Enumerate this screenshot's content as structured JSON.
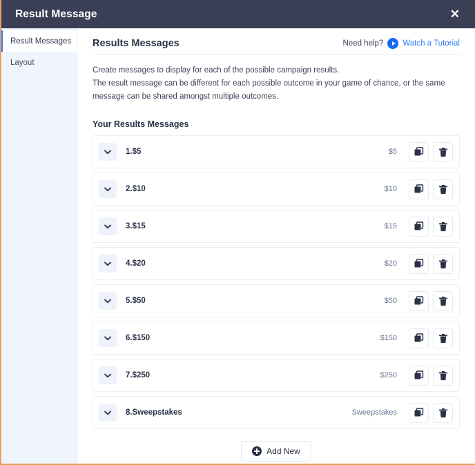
{
  "titlebar": {
    "title": "Result Message",
    "close_label": "✕"
  },
  "sidebar": {
    "items": [
      {
        "label": "Result Messages",
        "active": true
      },
      {
        "label": "Layout",
        "active": false
      }
    ]
  },
  "main": {
    "title": "Results Messages",
    "help": {
      "prompt": "Need help?",
      "link_label": "Watch a Tutorial",
      "play_icon": "play-circle-icon"
    },
    "description": [
      "Create messages to display for each of the possible campaign results.",
      "The result message can be different for each possible outcome in your game of chance, or the same message can be shared amongst multiple outcomes."
    ],
    "section_title": "Your Results Messages",
    "rows": [
      {
        "label": "1.$5",
        "value": "$5"
      },
      {
        "label": "2.$10",
        "value": "$10"
      },
      {
        "label": "3.$15",
        "value": "$15"
      },
      {
        "label": "4.$20",
        "value": "$20"
      },
      {
        "label": "5.$50",
        "value": "$50"
      },
      {
        "label": "6.$150",
        "value": "$150"
      },
      {
        "label": "7.$250",
        "value": "$250"
      },
      {
        "label": "8.Sweepstakes",
        "value": "Sweepstakes"
      }
    ],
    "row_icons": {
      "expand": "chevron-down-icon",
      "duplicate": "copy-icon",
      "delete": "trash-icon"
    },
    "add_button": {
      "label": "Add New",
      "icon": "plus-circle-icon"
    }
  },
  "colors": {
    "titlebar_bg": "#3a3f56",
    "accent_blue": "#2f7dfb",
    "play_blue": "#1569f5",
    "sidebar_bg": "#f0f4fc",
    "text_dark": "#2b3147",
    "value_text": "#6d7795",
    "window_border": "#e8a15c"
  }
}
